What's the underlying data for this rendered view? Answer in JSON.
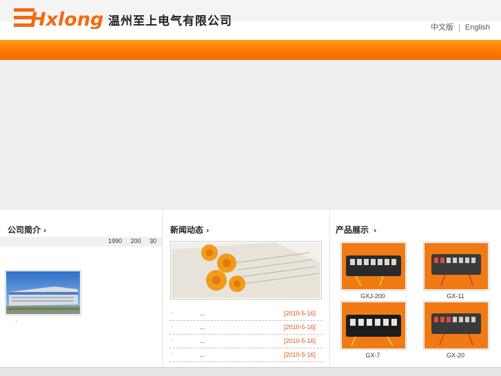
{
  "header": {
    "logo_text": "Hxlong",
    "company_name": "温州至上电气有限公司",
    "lang_cn": "中文版",
    "lang_separator": "|",
    "lang_en": "English"
  },
  "colors": {
    "brand_orange": "#ff7a00",
    "date_orange": "#d2581b"
  },
  "about": {
    "title": "公司简介",
    "arrow": "›",
    "intro_text": "1990 200 30",
    "footer_dot": "·"
  },
  "news": {
    "title": "新闻动态",
    "arrow": "›",
    "bullet": "◦",
    "items": [
      {
        "title": "...",
        "date": "[2010-5-16]"
      },
      {
        "title": "...",
        "date": "[2010-5-16]"
      },
      {
        "title": "...",
        "date": "[2010-5-16]"
      },
      {
        "title": "...",
        "date": "[2010-5-16]"
      }
    ]
  },
  "products": {
    "title": "产品展示",
    "arrow": "›",
    "items": [
      {
        "name": "GXJ-200"
      },
      {
        "name": "GX-11"
      },
      {
        "name": "GX-7"
      },
      {
        "name": "GX-20"
      }
    ]
  }
}
